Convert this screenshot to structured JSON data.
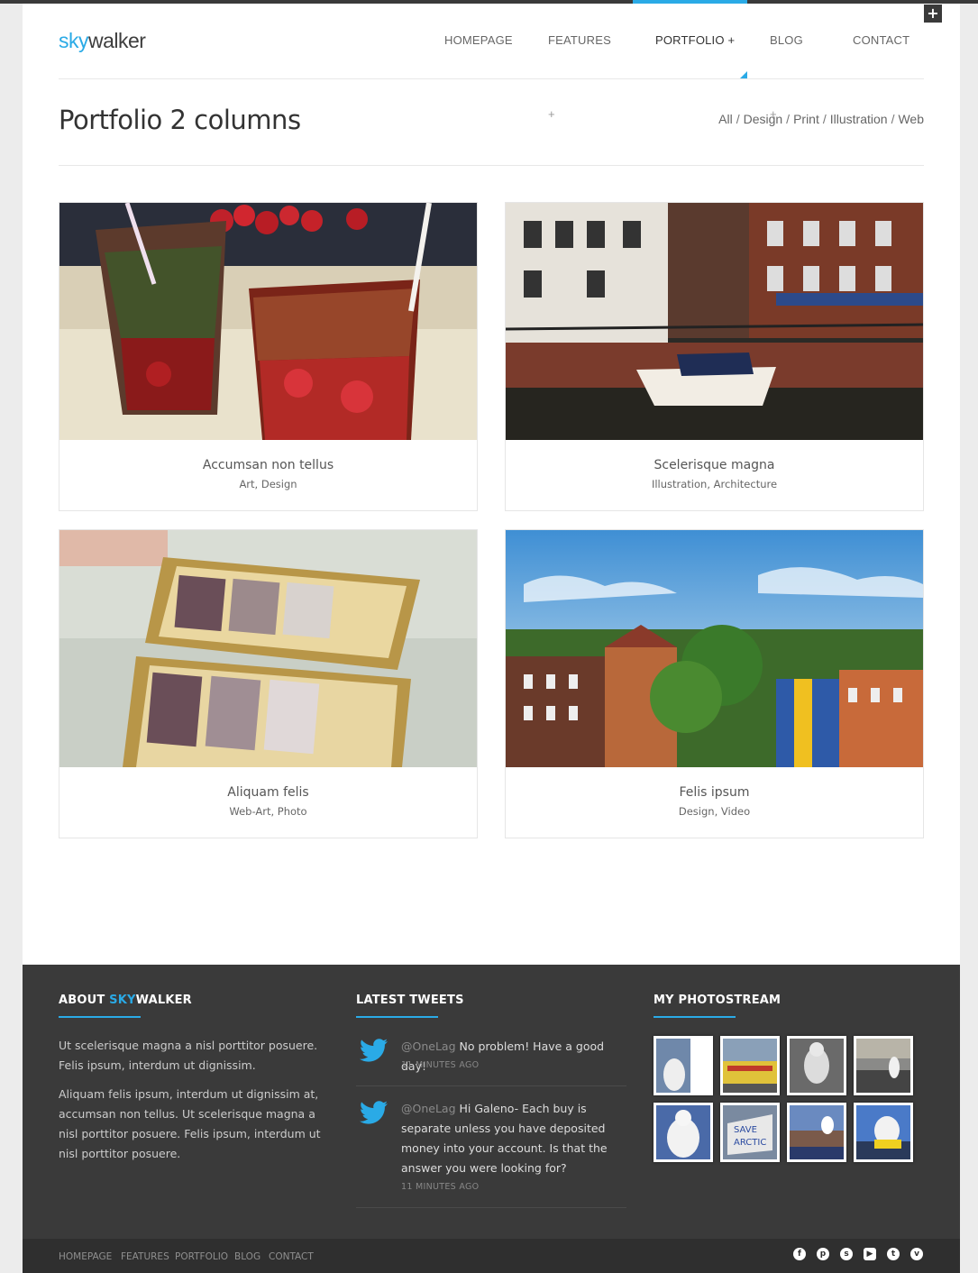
{
  "brand": {
    "part1": "sky",
    "part2": "walker",
    "accent": "#2aaae6"
  },
  "nav": {
    "homepage": "HOMEPAGE",
    "features": "FEATURES",
    "portfolio": "PORTFOLIO",
    "blog": "BLOG",
    "contact": "CONTACT",
    "plus": "+"
  },
  "page": {
    "title": "Portfolio 2 columns",
    "filters": [
      "All",
      "Design",
      "Print",
      "Illustration",
      "Web"
    ],
    "separator": "/"
  },
  "portfolio": [
    {
      "title": "Accumsan non tellus",
      "categories": "Art, Design",
      "image": "cocktail-glasses-photo"
    },
    {
      "title": "Scelerisque magna",
      "categories": "Illustration, Architecture",
      "image": "canal-boat-photo"
    },
    {
      "title": "Aliquam felis",
      "categories": "Web-Art, Photo",
      "image": "eyeshadow-palette-photo"
    },
    {
      "title": "Felis ipsum",
      "categories": "Design, Video",
      "image": "city-rooftops-photo"
    }
  ],
  "footer": {
    "about": {
      "title_prefix": "ABOUT ",
      "title_accent": "SKY",
      "title_suffix": "WALKER",
      "p1": "Ut scelerisque magna a nisl porttitor posuere. Felis ipsum, interdum ut dignissim.",
      "p2": "Aliquam felis ipsum, interdum ut dignissim at, accumsan non tellus. Ut scelerisque magna a nisl porttitor posuere. Felis ipsum, interdum ut nisl porttitor posuere."
    },
    "tweets": {
      "title": "LATEST TWEETS",
      "items": [
        {
          "user": "@OneLag",
          "text": "No problem! Have a good day!",
          "ago": "11 MINUTES AGO"
        },
        {
          "user": "@OneLag",
          "text": "Hi Galeno- Each buy is separate unless you have deposited money into your account. Is that the answer you were looking for?",
          "ago": "11 MINUTES AGO"
        }
      ]
    },
    "photostream": {
      "title": "MY PHOTOSTREAM"
    }
  },
  "bottom_nav": [
    "HOMEPAGE",
    "FEATURES",
    "PORTFOLIO",
    "BLOG",
    "CONTACT"
  ],
  "social_icons": [
    "facebook-icon",
    "pinterest-icon",
    "skype-icon",
    "youtube-icon",
    "twitter-icon",
    "vimeo-icon"
  ]
}
